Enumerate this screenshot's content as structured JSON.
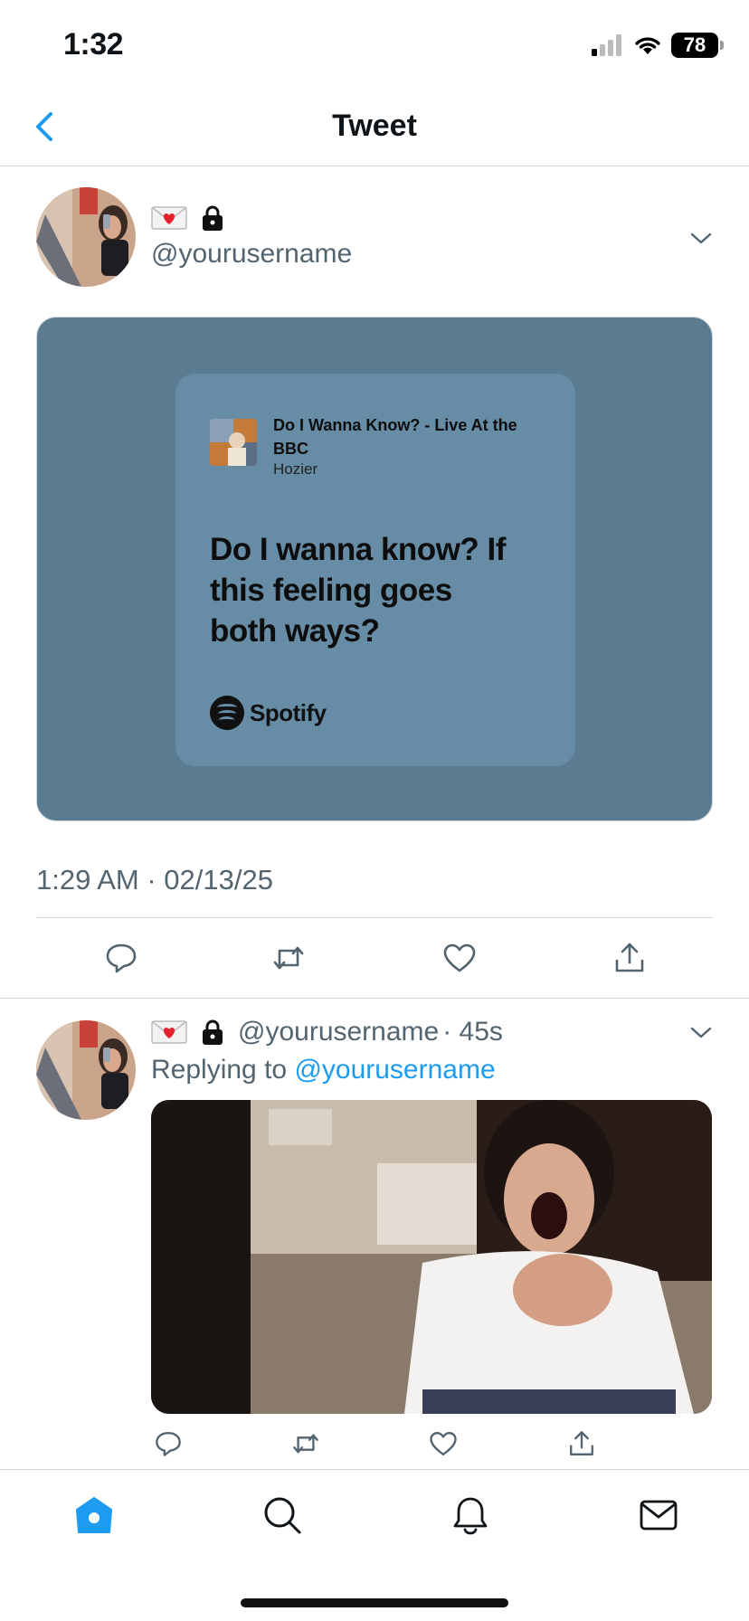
{
  "status_bar": {
    "time": "1:32",
    "battery": "78"
  },
  "header": {
    "title": "Tweet"
  },
  "tweet": {
    "handle": "@yourusername",
    "timestamp": "1:29 AM · 02/13/25",
    "media": {
      "song_title": "Do I Wanna Know? - Live At the BBC",
      "artist": "Hozier",
      "lyrics": "Do I wanna know? If this feeling goes both ways?",
      "brand": "Spotify",
      "card_color": "#668ca6",
      "background_color": "#5a7b90"
    }
  },
  "reply": {
    "handle": "@yourusername",
    "time": "· 45s",
    "replying_prefix": "Replying to",
    "replying_to": "@yourusername"
  },
  "icons": {
    "header": [
      "back-chevron-icon"
    ],
    "actions": [
      "reply-icon",
      "retweet-icon",
      "like-icon",
      "share-icon"
    ],
    "tabs": [
      "home-icon",
      "search-icon",
      "notifications-icon",
      "messages-icon"
    ]
  },
  "colors": {
    "accent": "#1d9bf0",
    "secondary_text": "#536471",
    "divider": "#cfd9de"
  }
}
